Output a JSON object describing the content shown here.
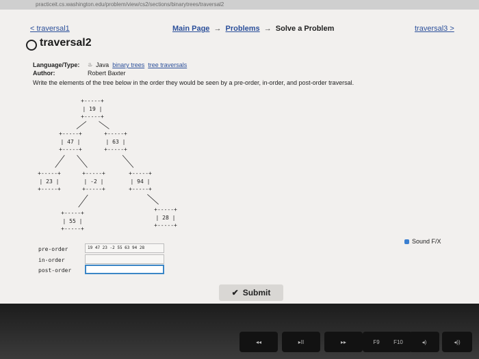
{
  "browser": {
    "url": "practiceit.cs.washington.edu/problem/view/cs2/sections/binarytrees/traversal2"
  },
  "nav": {
    "prev": "< traversal1",
    "next": "traversal3 >",
    "breadcrumb": [
      "Main Page",
      "Problems",
      "Solve a Problem"
    ]
  },
  "problem": {
    "title": "traversal2",
    "language_label": "Language/Type:",
    "language_tags": [
      "Java",
      "binary trees",
      "tree traversals"
    ],
    "author_label": "Author:",
    "author": "Robert Baxter",
    "description": "Write the elements of the tree below in the order they would be seen by a pre-order, in-order, and post-order traversal."
  },
  "tree": {
    "nodes": [
      {
        "id": "n19",
        "value": "19"
      },
      {
        "id": "n47",
        "value": "47"
      },
      {
        "id": "n63",
        "value": "63"
      },
      {
        "id": "n23",
        "value": "23"
      },
      {
        "id": "n-2",
        "value": "-2"
      },
      {
        "id": "n94",
        "value": "94"
      },
      {
        "id": "n55",
        "value": "55"
      },
      {
        "id": "n28",
        "value": "28"
      }
    ],
    "edges": [
      [
        "n19",
        "n47"
      ],
      [
        "n19",
        "n63"
      ],
      [
        "n47",
        "n23"
      ],
      [
        "n47",
        "n-2"
      ],
      [
        "n63",
        "n94"
      ],
      [
        "n-2",
        "n55"
      ],
      [
        "n94",
        "n28"
      ]
    ]
  },
  "answers": [
    {
      "label": "pre-order",
      "value": "19 47 23 -2 55 63 94 28"
    },
    {
      "label": "in-order",
      "value": ""
    },
    {
      "label": "post-order",
      "value": ""
    }
  ],
  "sound_label": "Sound F/X",
  "submit_label": "Submit",
  "keyboard": {
    "keys": [
      "◂◂",
      "▸II",
      "▸▸",
      "F9",
      "F10",
      "◂)",
      "◂))"
    ]
  }
}
